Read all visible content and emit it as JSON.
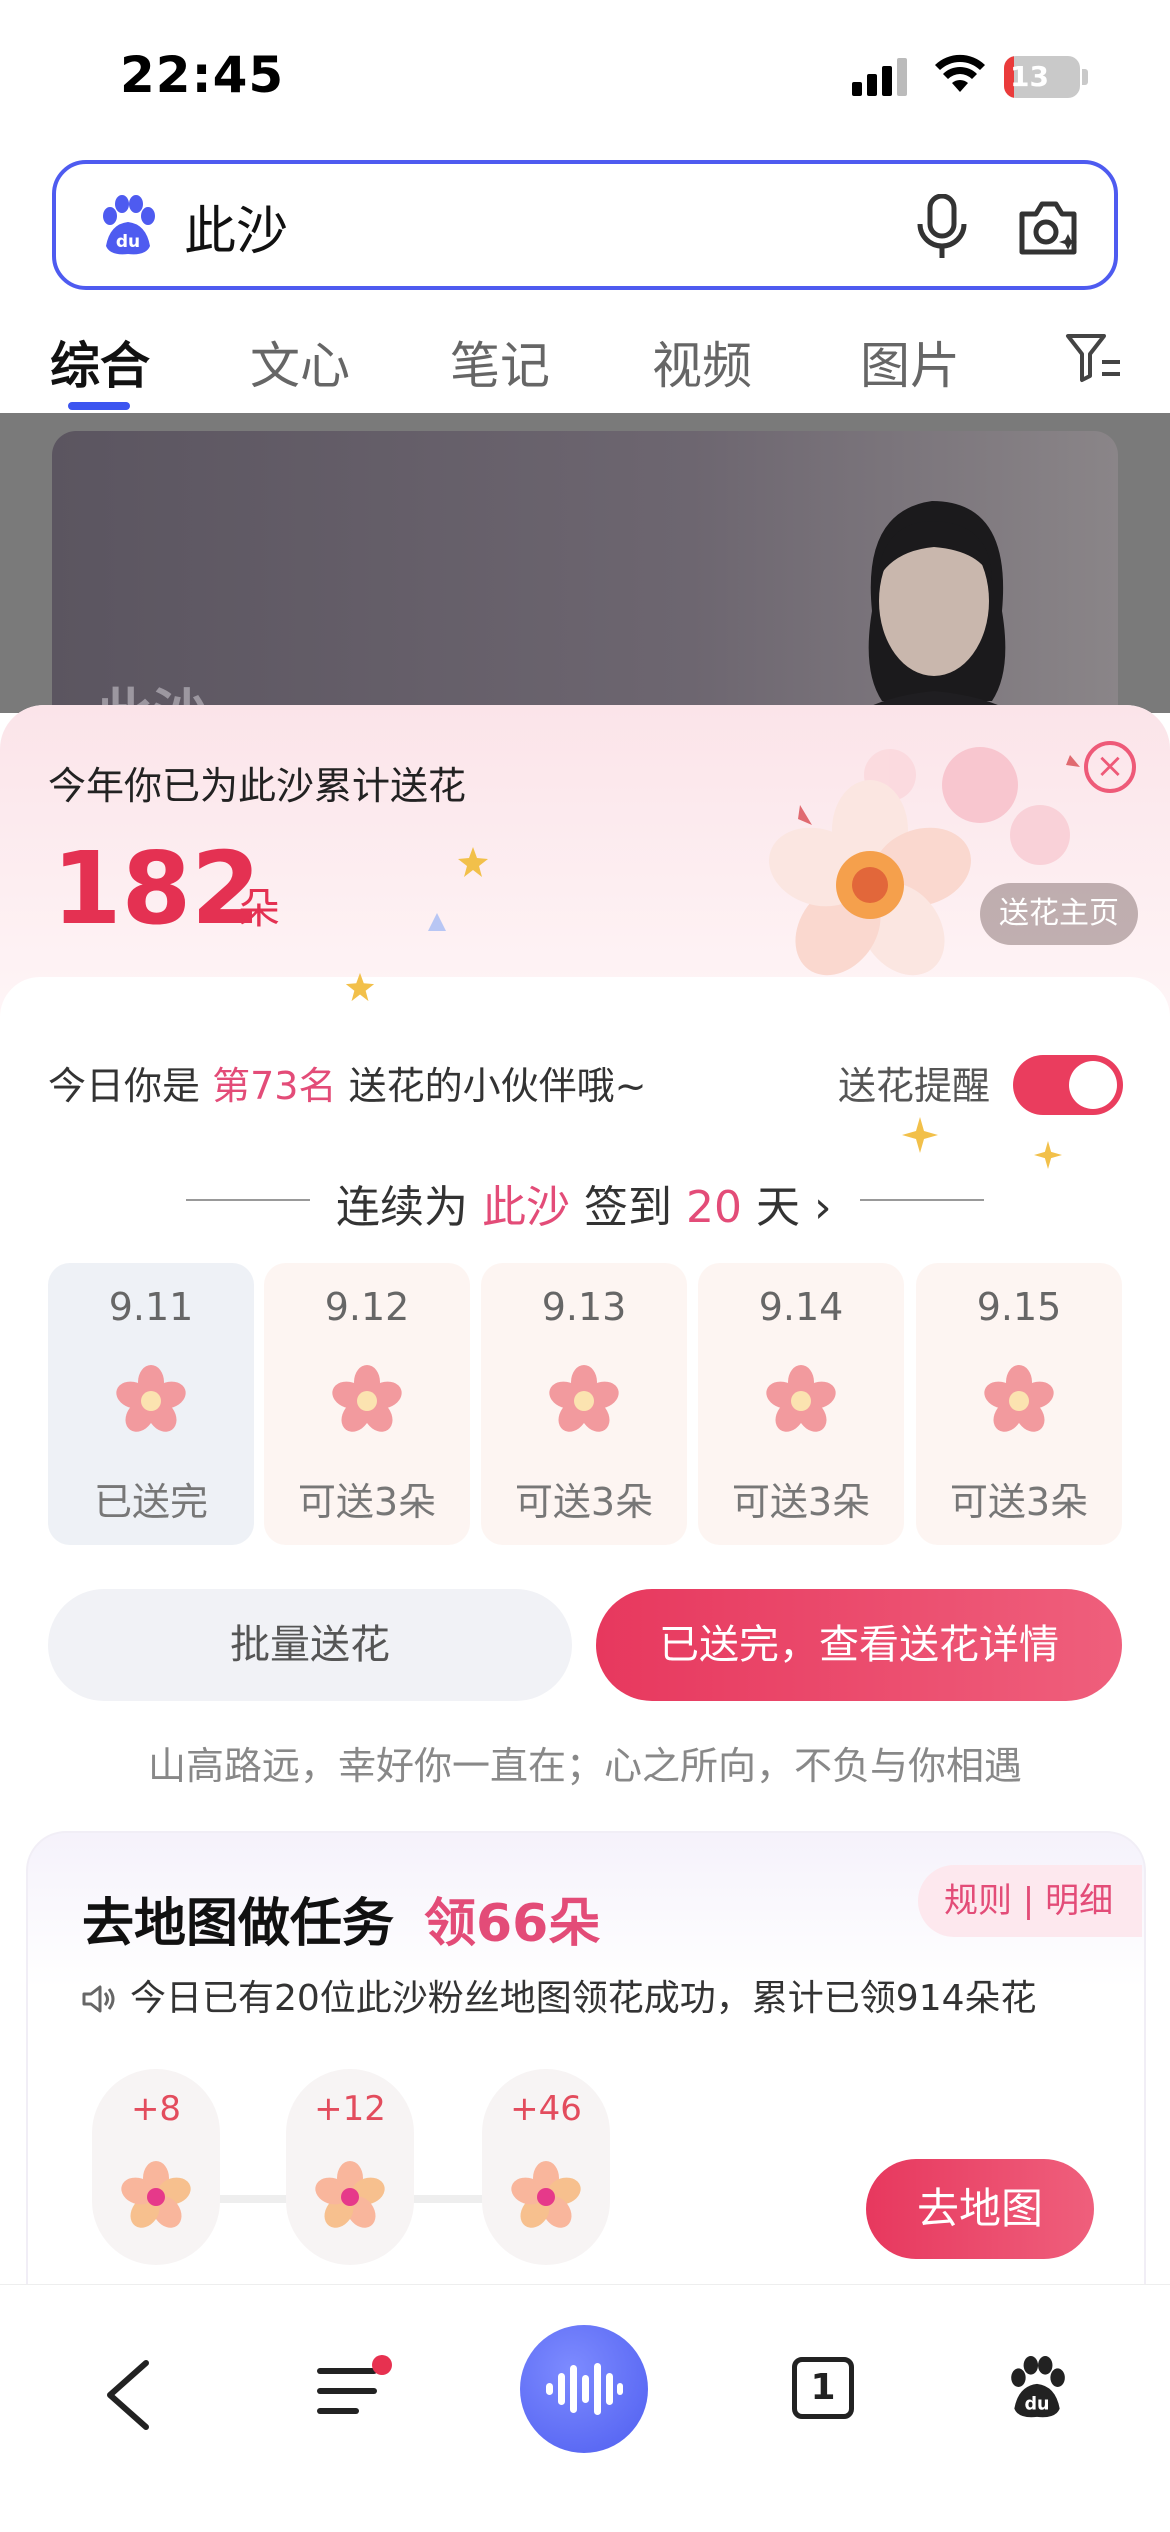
{
  "status_bar": {
    "time": "22:45",
    "battery": "13",
    "battery_level": 0.13
  },
  "search": {
    "query": "此沙"
  },
  "tabs": [
    {
      "label": "综合"
    },
    {
      "label": "文心"
    },
    {
      "label": "笔记"
    },
    {
      "label": "视频"
    },
    {
      "label": "图片"
    }
  ],
  "hero": {
    "name": "此沙"
  },
  "flower_panel": {
    "year_title": "今年你已为此沙累计送花",
    "count": "182",
    "count_unit": "朵",
    "home_button": "送花主页",
    "close_icon": "close-circle-icon",
    "rank_prefix": "今日你是",
    "rank_value": "第73名",
    "rank_suffix": "送花的小伙伴哦~",
    "remind_label": "送花提醒",
    "remind_on": true,
    "streak_prefix": "连续为",
    "streak_name": "此沙",
    "streak_mid": "签到",
    "streak_days": "20",
    "streak_suffix": "天",
    "days": [
      {
        "date": "9.11",
        "status": "已送完"
      },
      {
        "date": "9.12",
        "status": "可送3朵"
      },
      {
        "date": "9.13",
        "status": "可送3朵"
      },
      {
        "date": "9.14",
        "status": "可送3朵"
      },
      {
        "date": "9.15",
        "status": "可送3朵"
      }
    ],
    "batch_button": "批量送花",
    "detail_button": "已送完，查看送花详情",
    "quote": "山高路远，幸好你一直在；心之所向，不负与你相遇"
  },
  "map_task": {
    "title": "去地图做任务",
    "reward": "领66朵",
    "rule_link": "规则 | 明细",
    "info": "今日已有20位此沙粉丝地图领花成功，累计已领914朵花",
    "nodes": [
      {
        "amount": "+8"
      },
      {
        "amount": "+12"
      },
      {
        "amount": "+46"
      }
    ],
    "go_button": "去地图"
  },
  "bottom_nav": {
    "items": [
      "back-icon",
      "menu-icon",
      "voice-icon",
      "tabs-icon",
      "baidu-paw-icon"
    ],
    "tab_count": "1"
  },
  "colors": {
    "accent": "#e43152",
    "brand_blue": "#4e5bf0",
    "pink": "#e34c78"
  }
}
